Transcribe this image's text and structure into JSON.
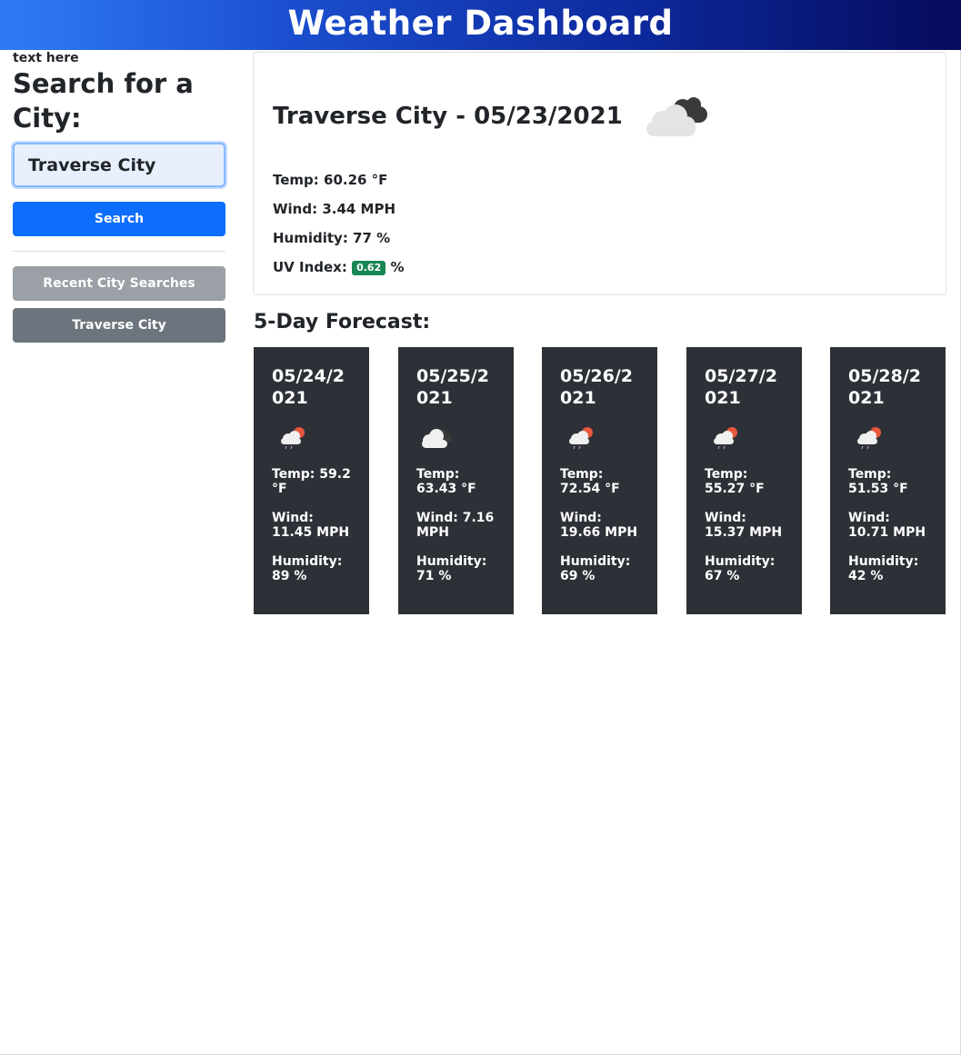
{
  "header": {
    "title": "Weather Dashboard"
  },
  "sidebar": {
    "small_text": "text here",
    "heading": "Search for a City:",
    "input_value": "Traverse City",
    "search_button": "Search",
    "recent_button": "Recent City Searches",
    "history": [
      "Traverse City"
    ]
  },
  "current": {
    "title": "Traverse City - 05/23/2021",
    "icon": "clouds-icon",
    "temp": "Temp: 60.26 °F",
    "wind": "Wind: 3.44 MPH",
    "humidity": "Humidity: 77 %",
    "uv_label": "UV Index:",
    "uv_value": "0.62",
    "uv_unit": "%",
    "uv_color": "#198754"
  },
  "forecast": {
    "heading": "5-Day Forecast:",
    "days": [
      {
        "date": "05/24/2021",
        "icon": "rain-sun-icon",
        "temp": "Temp: 59.2 °F",
        "wind": "Wind: 11.45 MPH",
        "humidity": "Humidity: 89 %"
      },
      {
        "date": "05/25/2021",
        "icon": "clouds-icon",
        "temp": "Temp: 63.43 °F",
        "wind": "Wind: 7.16 MPH",
        "humidity": "Humidity: 71 %"
      },
      {
        "date": "05/26/2021",
        "icon": "rain-sun-icon",
        "temp": "Temp: 72.54 °F",
        "wind": "Wind: 19.66 MPH",
        "humidity": "Humidity: 69 %"
      },
      {
        "date": "05/27/2021",
        "icon": "rain-sun-icon",
        "temp": "Temp: 55.27 °F",
        "wind": "Wind: 15.37 MPH",
        "humidity": "Humidity: 67 %"
      },
      {
        "date": "05/28/2021",
        "icon": "rain-sun-icon",
        "temp": "Temp: 51.53 °F",
        "wind": "Wind: 10.71 MPH",
        "humidity": "Humidity: 42 %"
      }
    ]
  }
}
